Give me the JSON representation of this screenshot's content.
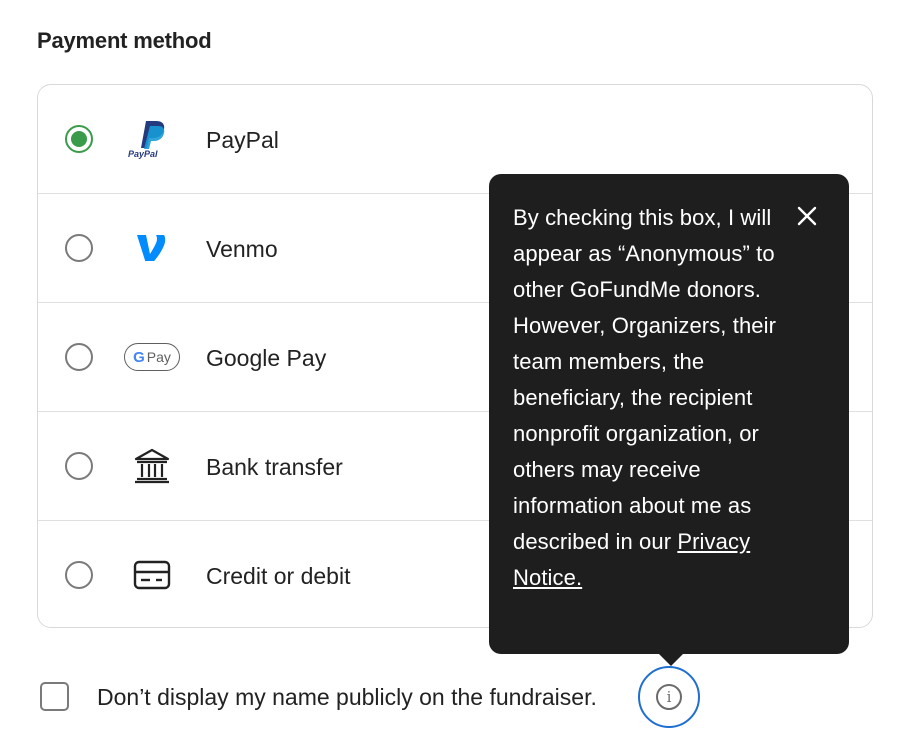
{
  "section": {
    "title": "Payment method"
  },
  "payment_methods": [
    {
      "label": "PayPal",
      "icon": "paypal-logo",
      "selected": true,
      "logo_text": "PayPal"
    },
    {
      "label": "Venmo",
      "icon": "venmo-logo",
      "selected": false
    },
    {
      "label": "Google Pay",
      "icon": "google-pay-logo",
      "selected": false,
      "logo_text": {
        "g": "G",
        "pay": "Pay"
      }
    },
    {
      "label": "Bank transfer",
      "icon": "bank-icon",
      "selected": false
    },
    {
      "label": "Credit or debit",
      "icon": "credit-card-icon",
      "selected": false
    }
  ],
  "anonymous": {
    "label": "Don’t display my name publicly on the fundraiser.",
    "checked": false,
    "info_icon": "info-icon"
  },
  "tooltip": {
    "text": "By checking this box, I will appear as “Anonymous” to other GoFundMe donors. However, Organizers, their team members, the beneficiary, the recipient nonprofit organization, or others may receive information about me as described in our ",
    "link": "Privacy Notice.",
    "close_icon": "close-icon"
  },
  "colors": {
    "selected_green": "#3a9b4b",
    "tooltip_bg": "#1e1e1e",
    "focus_blue": "#1f6fd1",
    "venmo_blue": "#008cff",
    "paypal_dark": "#253b80",
    "paypal_light": "#179bd7"
  }
}
